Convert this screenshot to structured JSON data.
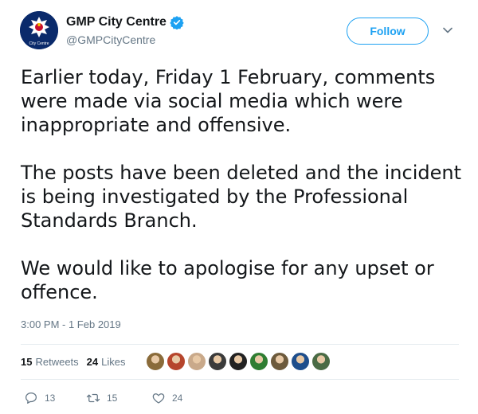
{
  "account": {
    "display_name": "GMP City Centre",
    "handle": "@GMPCityCentre",
    "avatar_text": "City Centre",
    "verified_icon": "verified-badge-icon"
  },
  "follow_label": "Follow",
  "tweet": {
    "paragraphs": [
      "Earlier today, Friday 1 February, comments were made via social media which were inappropriate and offensive.",
      "The posts have been deleted and the incident is being investigated by the Professional Standards Branch.",
      "We would like to apologise for any upset or offence."
    ],
    "timestamp": "3:00 PM - 1 Feb 2019"
  },
  "stats": {
    "retweets_count": "15",
    "retweets_label": "Retweets",
    "likes_count": "24",
    "likes_label": "Likes"
  },
  "likers": [
    {
      "icon": "liker-avatar-1",
      "color": "#8a6b3a"
    },
    {
      "icon": "liker-avatar-2",
      "color": "#b6452c"
    },
    {
      "icon": "liker-avatar-3",
      "color": "#c9a98a"
    },
    {
      "icon": "liker-avatar-4",
      "color": "#3b3b3b"
    },
    {
      "icon": "liker-avatar-5",
      "color": "#222222"
    },
    {
      "icon": "liker-avatar-6",
      "color": "#2f7d32"
    },
    {
      "icon": "liker-avatar-7",
      "color": "#6d5a3c"
    },
    {
      "icon": "liker-avatar-8",
      "color": "#1e4e8c"
    },
    {
      "icon": "liker-avatar-9",
      "color": "#4a6b45"
    }
  ],
  "actions": {
    "reply_count": "13",
    "retweet_count": "15",
    "like_count": "24"
  },
  "colors": {
    "accent": "#1da1f2",
    "muted": "#657786",
    "text": "#14171a"
  }
}
